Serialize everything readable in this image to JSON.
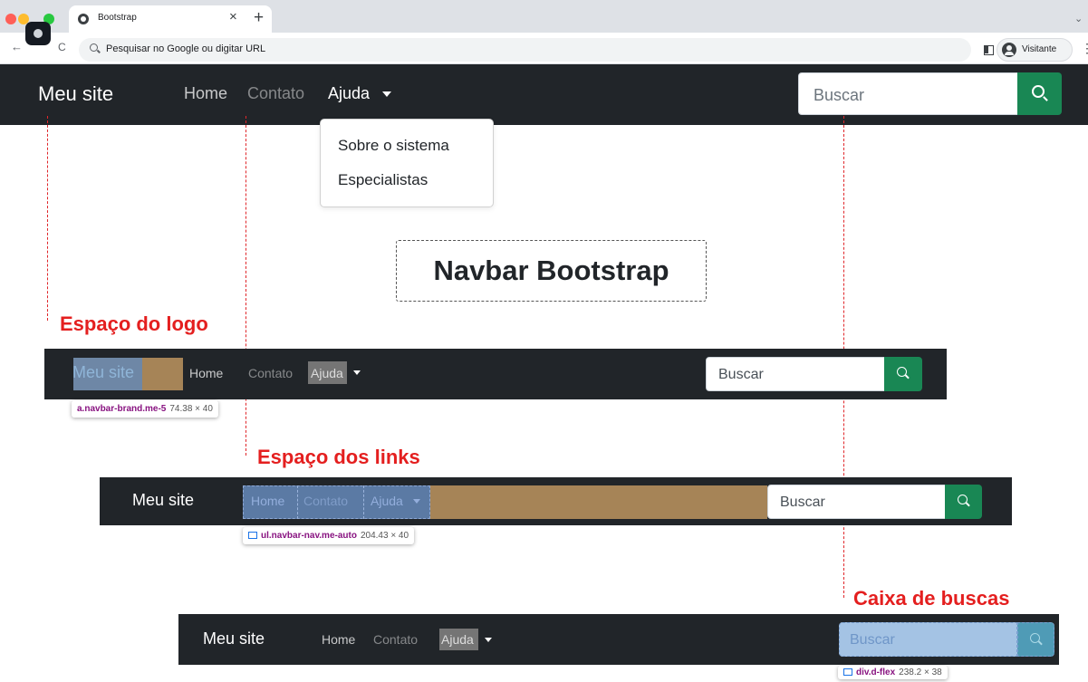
{
  "browser": {
    "tab_title": "Bootstrap",
    "tab_close": "×",
    "new_tab": "+",
    "omnibox_placeholder": "Pesquisar no Google ou digitar URL",
    "profile_name": "Visitante",
    "back": "←",
    "reload": "C",
    "menu": "⋮",
    "chevron": "⌄",
    "traffic_light_colors": [
      "#ff5f57",
      "#febc2e",
      "#28c840"
    ]
  },
  "navbar": {
    "brand": "Meu site",
    "links": [
      "Home",
      "Contato",
      "Ajuda"
    ],
    "search_placeholder": "Buscar",
    "search_button_icon": "search-icon",
    "background": "#212529",
    "button_color": "#198754"
  },
  "dropdown": {
    "items": [
      "Sobre o sistema",
      "Especialistas"
    ]
  },
  "heading": "Navbar Bootstrap",
  "annotations": {
    "logo_label": "Espaço do logo",
    "links_label": "Espaço dos links",
    "search_label": "Caixa de buscas",
    "guide_color": "#e0262a"
  },
  "devtools": {
    "brand_selector": "a.navbar-brand.me-5",
    "brand_size": "74.38 × 40",
    "nav_selector": "ul.navbar-nav.me-auto",
    "nav_size": "204.43 × 40",
    "search_selector": "div.d-flex",
    "search_size": "238.2 × 38",
    "highlight_content": "#6e87a6",
    "highlight_margin": "#a68457"
  }
}
